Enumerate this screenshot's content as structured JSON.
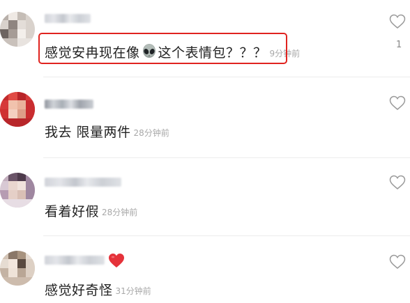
{
  "comments": [
    {
      "username": "",
      "text_before": "感觉安冉现在像",
      "emoji": "alien-face",
      "text_after": "这个表情包？？？",
      "time": "9分钟前",
      "likes": "1",
      "highlighted": true
    },
    {
      "username": "",
      "text": "我去 限量两件",
      "time": "28分钟前"
    },
    {
      "username": "",
      "text": "看着好假",
      "time": "28分钟前"
    },
    {
      "username": "",
      "name_emoji": "red-heart",
      "text": "感觉好奇怪",
      "time": "31分钟前"
    }
  ],
  "colors": {
    "highlight": "#e0231f",
    "time": "#a8a8a8",
    "like_icon": "#9a9a9a",
    "divider": "#ececec"
  },
  "icons": [
    "heart-outline-icon",
    "alien-emoji-icon",
    "red-heart-emoji-icon"
  ]
}
